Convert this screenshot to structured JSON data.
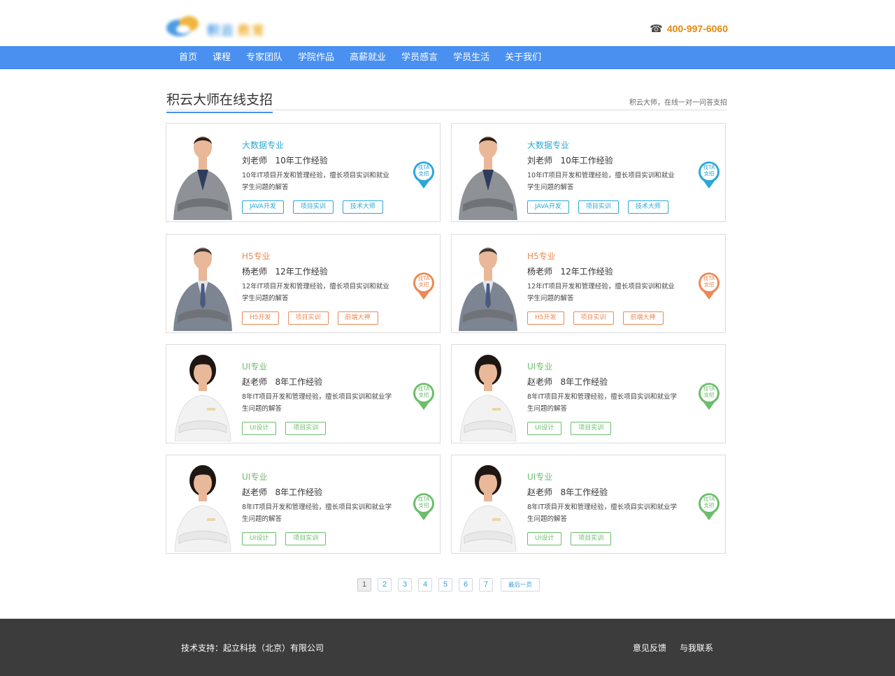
{
  "header": {
    "logo_text_a": "积云",
    "logo_text_b": "教育",
    "phone": "400-997-6060"
  },
  "nav": [
    "首页",
    "课程",
    "专家团队",
    "学院作品",
    "高薪就业",
    "学员感言",
    "学员生活",
    "关于我们"
  ],
  "section": {
    "title": "积云大师在线支招",
    "subtitle": "积云大师，在线一对一问答支招"
  },
  "colors": {
    "blue": "#2aa8d8",
    "orange": "#ea8a55",
    "green": "#6cbd6c",
    "nav": "#4a90f0"
  },
  "cards": [
    {
      "major": "大数据专业",
      "name": "刘老师   10年工作经验",
      "desc": "10年IT项目开发和管理经验，擅长项目实训和就业学生问题的解答",
      "tags": [
        "JAVA开发",
        "项目实训",
        "技术大师"
      ],
      "pin": [
        "找TA",
        "支招"
      ],
      "theme": "blue",
      "photo": "young-man"
    },
    {
      "major": "大数据专业",
      "name": "刘老师   10年工作经验",
      "desc": "10年IT项目开发和管理经验，擅长项目实训和就业学生问题的解答",
      "tags": [
        "JAVA开发",
        "项目实训",
        "技术大师"
      ],
      "pin": [
        "找TA",
        "支招"
      ],
      "theme": "blue",
      "photo": "young-man"
    },
    {
      "major": "H5专业",
      "name": "杨老师   12年工作经验",
      "desc": "12年IT项目开发和管理经验，擅长项目实训和就业学生问题的解答",
      "tags": [
        "H5开发",
        "项目实训",
        "前端大神"
      ],
      "pin": [
        "找TA",
        "支招"
      ],
      "theme": "orange",
      "photo": "older-man"
    },
    {
      "major": "H5专业",
      "name": "杨老师   12年工作经验",
      "desc": "12年IT项目开发和管理经验，擅长项目实训和就业学生问题的解答",
      "tags": [
        "H5开发",
        "项目实训",
        "前端大神"
      ],
      "pin": [
        "找TA",
        "支招"
      ],
      "theme": "orange",
      "photo": "older-man"
    },
    {
      "major": "UI专业",
      "name": "赵老师   8年工作经验",
      "desc": "8年IT项目开发和管理经验，擅长项目实训和就业学生问题的解答",
      "tags": [
        "UI设计",
        "项目实训"
      ],
      "pin": [
        "找TA",
        "支招"
      ],
      "theme": "green",
      "photo": "woman"
    },
    {
      "major": "UI专业",
      "name": "赵老师   8年工作经验",
      "desc": "8年IT项目开发和管理经验，擅长项目实训和就业学生问题的解答",
      "tags": [
        "UI设计",
        "项目实训"
      ],
      "pin": [
        "找TA",
        "支招"
      ],
      "theme": "green",
      "photo": "woman"
    },
    {
      "major": "UI专业",
      "name": "赵老师   8年工作经验",
      "desc": "8年IT项目开发和管理经验，擅长项目实训和就业学生问题的解答",
      "tags": [
        "UI设计",
        "项目实训"
      ],
      "pin": [
        "找TA",
        "支招"
      ],
      "theme": "green",
      "photo": "woman"
    },
    {
      "major": "UI专业",
      "name": "赵老师   8年工作经验",
      "desc": "8年IT项目开发和管理经验，擅长项目实训和就业学生问题的解答",
      "tags": [
        "UI设计",
        "项目实训"
      ],
      "pin": [
        "找TA",
        "支招"
      ],
      "theme": "green",
      "photo": "woman"
    }
  ],
  "pagination": {
    "pages": [
      "1",
      "2",
      "3",
      "4",
      "5",
      "6",
      "7"
    ],
    "current": "1",
    "last_label": "最后一页"
  },
  "footer": {
    "copyright": "技术支持：起立科技（北京）有限公司",
    "links": [
      "意见反馈",
      "与我联系"
    ]
  }
}
